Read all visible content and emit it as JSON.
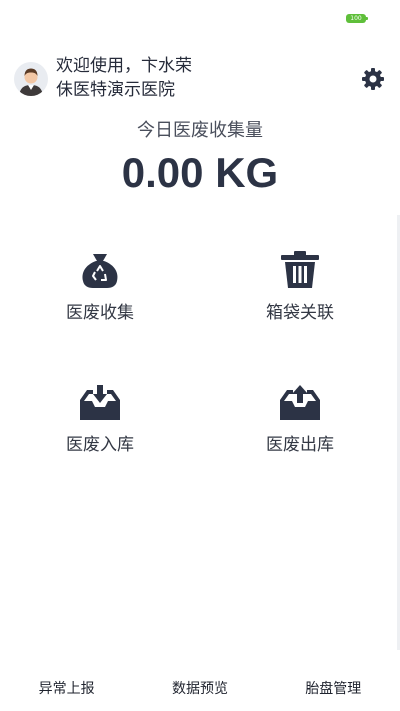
{
  "status_bar": {
    "battery": "100"
  },
  "header": {
    "welcome": "欢迎使用，卞水荣",
    "org": "佅医特演示医院"
  },
  "summary": {
    "label": "今日医废收集量",
    "value": "0.00 KG"
  },
  "actions": [
    {
      "label": "医废收集",
      "icon": "recycle-bag-icon"
    },
    {
      "label": "箱袋关联",
      "icon": "trash-bin-icon"
    },
    {
      "label": "医废入库",
      "icon": "inbox-in-icon"
    },
    {
      "label": "医废出库",
      "icon": "inbox-out-icon"
    }
  ],
  "bottom_nav": [
    {
      "label": "异常上报"
    },
    {
      "label": "数据预览"
    },
    {
      "label": "胎盘管理"
    }
  ],
  "colors": {
    "icon": "#2c3345",
    "battery": "#5fbf3a"
  }
}
